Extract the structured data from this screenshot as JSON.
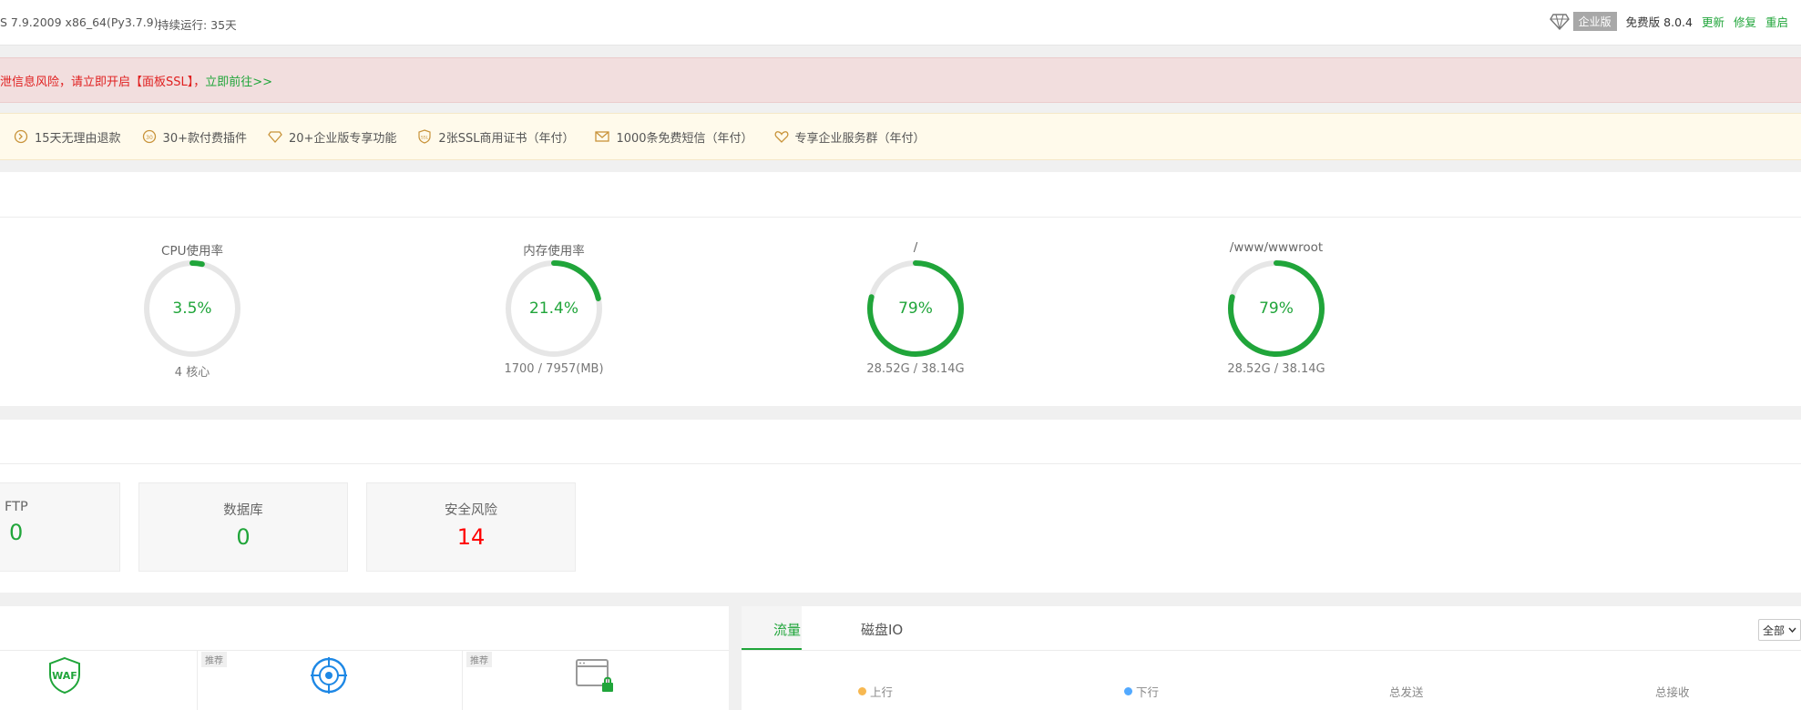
{
  "header": {
    "system_info": "S 7.9.2009 x86_64(Py3.7.9)",
    "uptime": "持续运行: 35天",
    "enterprise_label": "企业版",
    "free_version": "免费版 8.0.4",
    "update": "更新",
    "repair": "修复",
    "restart": "重启"
  },
  "warning": {
    "text": "泄信息风险，请立即开启【面板SSL】，",
    "link": "立即前往>>"
  },
  "perks": [
    {
      "icon": "refund-icon",
      "label": "15天无理由退款"
    },
    {
      "icon": "plugin-icon",
      "label": "30+款付费插件"
    },
    {
      "icon": "diamond-icon",
      "label": "20+企业版专享功能"
    },
    {
      "icon": "ssl-shield-icon",
      "label": "2张SSL商用证书（年付）"
    },
    {
      "icon": "mail-icon",
      "label": "1000条免费短信（年付）"
    },
    {
      "icon": "heart-service-icon",
      "label": "专享企业服务群（年付）"
    }
  ],
  "gauges": [
    {
      "title": "CPU使用率",
      "value": "3.5%",
      "percent": 3.5,
      "sub": "4 核心"
    },
    {
      "title": "内存使用率",
      "value": "21.4%",
      "percent": 21.4,
      "sub": "1700 / 7957(MB)"
    },
    {
      "title": "/",
      "value": "79%",
      "percent": 79,
      "sub": "28.52G / 38.14G"
    },
    {
      "title": "/www/wwwroot",
      "value": "79%",
      "percent": 79,
      "sub": "28.52G / 38.14G"
    }
  ],
  "overview": [
    {
      "label": "FTP",
      "value": "0"
    },
    {
      "label": "数据库",
      "value": "0"
    },
    {
      "label": "安全风险",
      "value": "14"
    }
  ],
  "software": {
    "tag": "推荐",
    "waf_text": "WAF"
  },
  "traffic": {
    "tabs": [
      "流量",
      "磁盘IO"
    ],
    "select": "全部",
    "legend": [
      {
        "label": "上行",
        "color": "#f7b851"
      },
      {
        "label": "下行",
        "color": "#52a9ff"
      },
      {
        "label": "总发送"
      },
      {
        "label": "总接收"
      }
    ]
  },
  "colors": {
    "accent": "#20a53a",
    "danger": "#ff0000",
    "track": "#e6e6e6"
  }
}
